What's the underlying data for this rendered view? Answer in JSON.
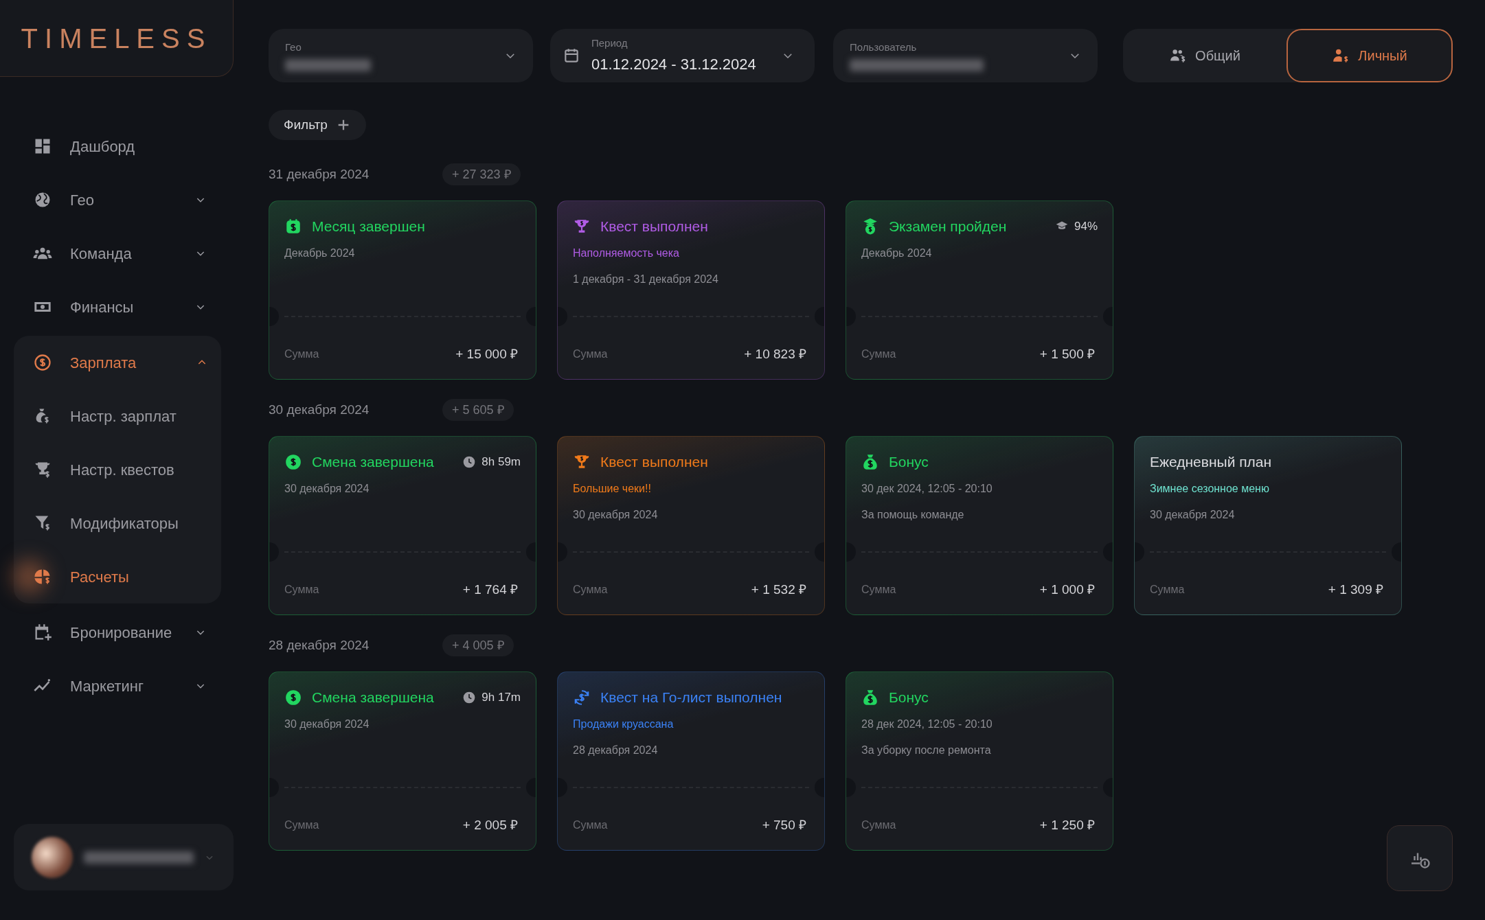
{
  "logo": "TIMELESS",
  "sidebar": {
    "items": [
      {
        "label": "Дашборд",
        "selected": false
      },
      {
        "label": "Гео",
        "selected": false,
        "expanded": false
      },
      {
        "label": "Команда",
        "selected": false,
        "expanded": false
      },
      {
        "label": "Финансы",
        "selected": false,
        "expanded": false
      },
      {
        "label": "Зарплата",
        "selected": true,
        "expanded": true,
        "children": [
          {
            "label": "Настр. зарплат",
            "selected": false
          },
          {
            "label": "Настр. квестов",
            "selected": false
          },
          {
            "label": "Модификаторы",
            "selected": false
          },
          {
            "label": "Расчеты",
            "selected": true
          }
        ]
      },
      {
        "label": "Бронирование",
        "selected": false,
        "expanded": false
      },
      {
        "label": "Маркетинг",
        "selected": false,
        "expanded": false
      }
    ]
  },
  "filters": {
    "geo": {
      "label": "Гео"
    },
    "period": {
      "label": "Период",
      "value": "01.12.2024 - 31.12.2024"
    },
    "user": {
      "label": "Пользователь"
    }
  },
  "mode_toggle": [
    {
      "label": "Общий",
      "selected": false
    },
    {
      "label": "Личный",
      "selected": true
    }
  ],
  "filter_button": "Фильтр",
  "days": [
    {
      "date": "31 декабря 2024",
      "total": "+ 27 323 ₽",
      "cards": [
        {
          "kind": "month",
          "color": "#22d660",
          "title": "Месяц завершен",
          "lines": [
            "Декабрь 2024"
          ],
          "sum_label": "Сумма",
          "amount": "+ 15 000 ₽"
        },
        {
          "kind": "quest",
          "color": "#b15ce6",
          "title": "Квест выполнен",
          "subtitle": "Наполняемость чека",
          "lines": [
            "1 декабря - 31 декабря 2024"
          ],
          "sum_label": "Сумма",
          "amount": "+ 10 823 ₽"
        },
        {
          "kind": "exam",
          "color": "#22d660",
          "title": "Экзамен пройден",
          "badge": {
            "kind": "cap",
            "text": "94%"
          },
          "lines": [
            "Декабрь 2024"
          ],
          "sum_label": "Сумма",
          "amount": "+ 1 500 ₽"
        }
      ]
    },
    {
      "date": "30 декабря 2024",
      "total": "+ 5 605 ₽",
      "cards": [
        {
          "kind": "shift",
          "color": "#22d660",
          "title": "Смена завершена",
          "badge": {
            "kind": "clock",
            "text": "8h 59m"
          },
          "lines": [
            "30 декабря 2024"
          ],
          "sum_label": "Сумма",
          "amount": "+ 1 764 ₽"
        },
        {
          "kind": "quest",
          "color": "#f07a1a",
          "title": "Квест выполнен",
          "subtitle": "Большие чеки!!",
          "lines": [
            "30 декабря 2024"
          ],
          "sum_label": "Сумма",
          "amount": "+ 1 532 ₽"
        },
        {
          "kind": "bonus",
          "color": "#22d660",
          "title": "Бонус",
          "lines": [
            "30 дек 2024, 12:05 - 20:10",
            "За помощь команде"
          ],
          "sum_label": "Сумма",
          "amount": "+ 1 000 ₽"
        },
        {
          "kind": "plan",
          "color": "#6fe3d0",
          "title": "Ежедневный план",
          "subtitle": "Зимнее сезонное меню",
          "lines": [
            "30 декабря 2024"
          ],
          "sum_label": "Сумма",
          "amount": "+ 1 309 ₽"
        }
      ]
    },
    {
      "date": "28 декабря 2024",
      "total": "+ 4 005 ₽",
      "cards": [
        {
          "kind": "shift",
          "color": "#22d660",
          "title": "Смена завершена",
          "badge": {
            "kind": "clock",
            "text": "9h 17m"
          },
          "lines": [
            "30 декабря 2024"
          ],
          "sum_label": "Сумма",
          "amount": "+ 2 005 ₽"
        },
        {
          "kind": "golist",
          "color": "#3b82f6",
          "title": "Квест на Го-лист выполнен",
          "subtitle": "Продажи круассана",
          "lines": [
            "28 декабря 2024"
          ],
          "sum_label": "Сумма",
          "amount": "+ 750 ₽"
        },
        {
          "kind": "bonus",
          "color": "#22d660",
          "title": "Бонус",
          "lines": [
            "28 дек 2024, 12:05 - 20:10",
            "За уборку после ремонта"
          ],
          "sum_label": "Сумма",
          "amount": "+ 1 250 ₽"
        }
      ]
    }
  ]
}
